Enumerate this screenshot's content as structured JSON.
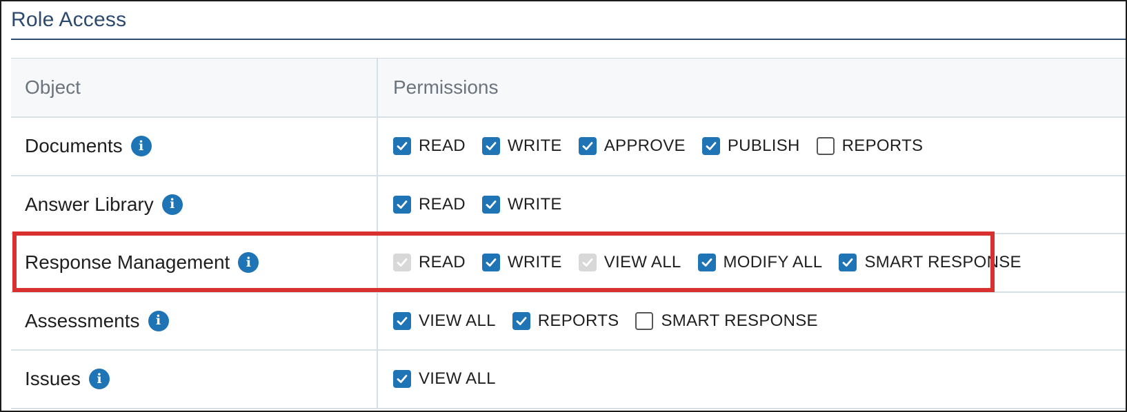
{
  "title": "Role Access",
  "table": {
    "headers": {
      "object": "Object",
      "permissions": "Permissions"
    },
    "rows": [
      {
        "object": "Documents",
        "perms": [
          {
            "label": "READ",
            "state": "checked"
          },
          {
            "label": "WRITE",
            "state": "checked"
          },
          {
            "label": "APPROVE",
            "state": "checked"
          },
          {
            "label": "PUBLISH",
            "state": "checked"
          },
          {
            "label": "REPORTS",
            "state": "unchecked"
          }
        ]
      },
      {
        "object": "Answer Library",
        "perms": [
          {
            "label": "READ",
            "state": "checked"
          },
          {
            "label": "WRITE",
            "state": "checked"
          }
        ]
      },
      {
        "object": "Response Management",
        "highlighted": true,
        "perms": [
          {
            "label": "READ",
            "state": "disabled"
          },
          {
            "label": "WRITE",
            "state": "checked"
          },
          {
            "label": "VIEW ALL",
            "state": "disabled"
          },
          {
            "label": "MODIFY ALL",
            "state": "checked"
          },
          {
            "label": "SMART RESPONSE",
            "state": "checked"
          }
        ]
      },
      {
        "object": "Assessments",
        "perms": [
          {
            "label": "VIEW ALL",
            "state": "checked"
          },
          {
            "label": "REPORTS",
            "state": "checked"
          },
          {
            "label": "SMART RESPONSE",
            "state": "unchecked"
          }
        ]
      },
      {
        "object": "Issues",
        "perms": [
          {
            "label": "VIEW ALL",
            "state": "checked"
          }
        ]
      }
    ]
  },
  "icons": {
    "info": "info-icon",
    "check": "checkmark-icon"
  },
  "colors": {
    "accent": "#1f74b5",
    "title": "#2c4a6e",
    "highlight": "#d8312f",
    "disabled": "#d8d8d8"
  }
}
